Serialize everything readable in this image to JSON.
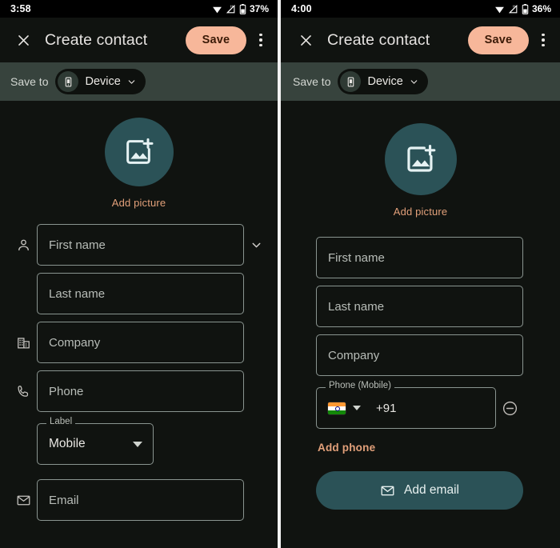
{
  "screens": [
    {
      "id": "left",
      "status": {
        "time": "3:58",
        "battery": "37%",
        "network_icon": "signal-h-icon",
        "wifi_icon": "wifi-icon",
        "battery_icon": "battery-icon"
      },
      "appbar": {
        "close_icon": "close-icon",
        "title": "Create contact",
        "save_label": "Save",
        "overflow_icon": "kebab-menu-icon"
      },
      "saveto": {
        "label": "Save to",
        "account_icon": "device-icon",
        "account": "Device",
        "chevron_icon": "chevron-down-icon"
      },
      "avatar": {
        "icon": "add-image-icon",
        "caption": "Add picture"
      },
      "fields": [
        {
          "icon": "person-icon",
          "placeholder": "First name",
          "trailing_icon": "chevron-down-icon"
        },
        {
          "icon": "",
          "placeholder": "Last name",
          "trailing_icon": ""
        },
        {
          "icon": "business-icon",
          "placeholder": "Company",
          "trailing_icon": ""
        },
        {
          "icon": "phone-icon",
          "placeholder": "Phone",
          "trailing_icon": ""
        }
      ],
      "label_select": {
        "notch": "Label",
        "value": "Mobile",
        "arrow_icon": "dropdown-triangle-icon"
      },
      "email_field": {
        "icon": "email-icon",
        "placeholder": "Email"
      }
    },
    {
      "id": "right",
      "status": {
        "time": "4:00",
        "battery": "36%",
        "network_icon": "signal-h-icon",
        "wifi_icon": "wifi-icon",
        "battery_icon": "battery-icon"
      },
      "appbar": {
        "close_icon": "close-icon",
        "title": "Create contact",
        "save_label": "Save",
        "overflow_icon": "kebab-menu-icon"
      },
      "saveto": {
        "label": "Save to",
        "account_icon": "device-icon",
        "account": "Device",
        "chevron_icon": "chevron-down-icon"
      },
      "avatar": {
        "icon": "add-image-icon",
        "caption": "Add picture"
      },
      "fields": [
        {
          "placeholder": "First name"
        },
        {
          "placeholder": "Last name"
        },
        {
          "placeholder": "Company"
        }
      ],
      "phone": {
        "notch": "Phone (Mobile)",
        "flag_icon": "india-flag-icon",
        "flag_chevron_icon": "dropdown-triangle-icon",
        "dial_code": "+91",
        "remove_icon": "remove-circle-icon"
      },
      "add_phone_label": "Add phone",
      "add_email": {
        "icon": "email-icon",
        "label": "Add email"
      }
    }
  ],
  "colors": {
    "background": "#101310",
    "save_button": "#f7b79a",
    "accent_orange": "#e2a07a",
    "teal": "#2b5257",
    "saveto_bar": "#37433d",
    "field_border": "#8a9490"
  }
}
